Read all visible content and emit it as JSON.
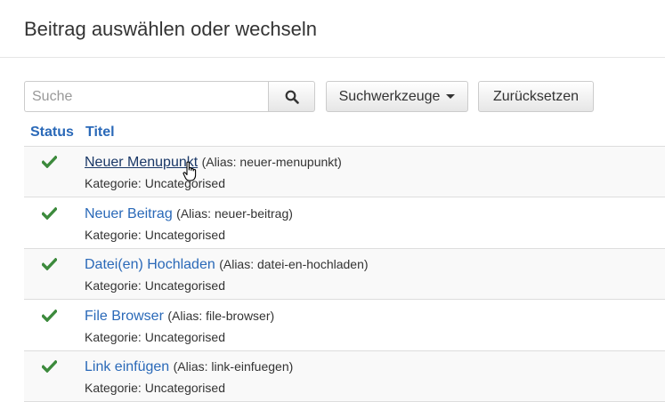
{
  "modal": {
    "title": "Beitrag auswählen oder wechseln"
  },
  "search": {
    "placeholder": "Suche",
    "value": "",
    "search_icon": "search-icon",
    "tools_label": "Suchwerkzeuge",
    "reset_label": "Zurücksetzen"
  },
  "table": {
    "headers": {
      "status": "Status",
      "title": "Titel"
    },
    "rows": [
      {
        "status_icon": "check-icon",
        "title": "Neuer Menupunkt",
        "alias": "(Alias: neuer-menupunkt)",
        "category": "Kategorie: Uncategorised"
      },
      {
        "status_icon": "check-icon",
        "title": "Neuer Beitrag",
        "alias": "(Alias: neuer-beitrag)",
        "category": "Kategorie: Uncategorised"
      },
      {
        "status_icon": "check-icon",
        "title": "Datei(en) Hochladen",
        "alias": "(Alias: datei-en-hochladen)",
        "category": "Kategorie: Uncategorised"
      },
      {
        "status_icon": "check-icon",
        "title": "File Browser",
        "alias": "(Alias: file-browser)",
        "category": "Kategorie: Uncategorised"
      },
      {
        "status_icon": "check-icon",
        "title": "Link einfügen",
        "alias": "(Alias: link-einfuegen)",
        "category": "Kategorie: Uncategorised"
      }
    ]
  },
  "colors": {
    "link": "#2a69b8",
    "check": "#3c8a3c",
    "stripe": "#f9f9f9"
  }
}
